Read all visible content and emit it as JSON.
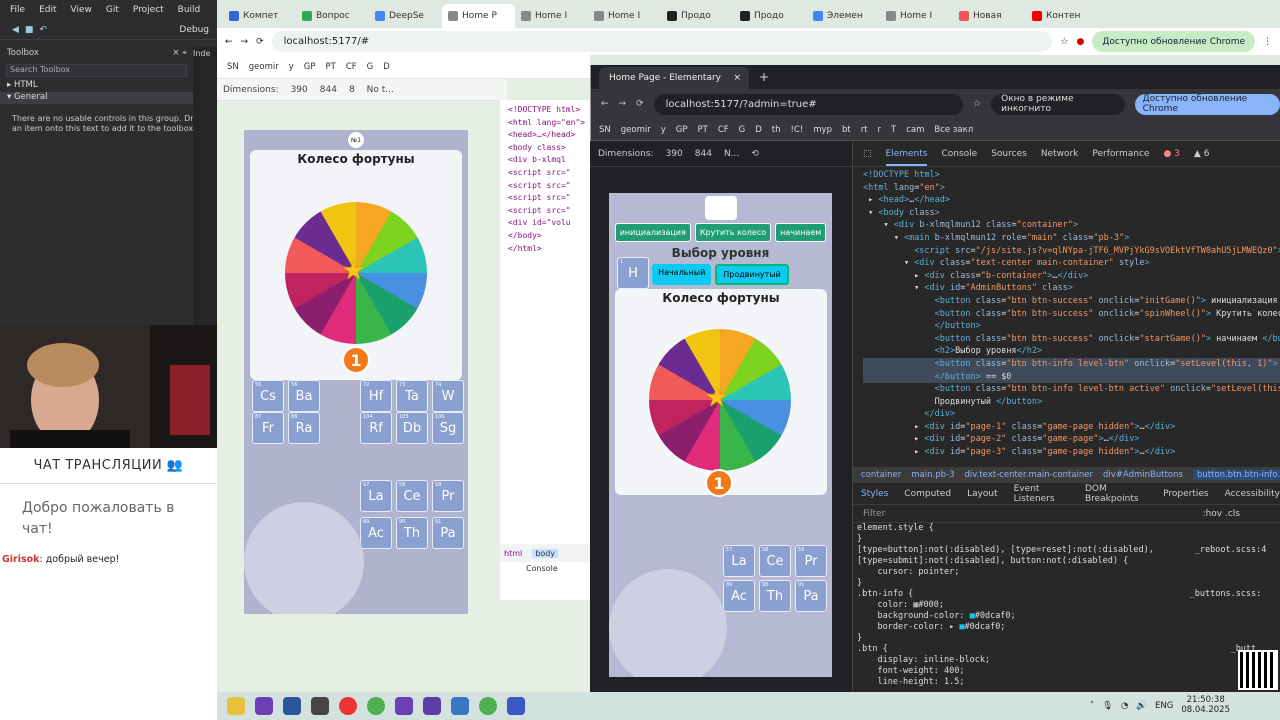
{
  "vs": {
    "menu": [
      "File",
      "Edit",
      "View",
      "Git",
      "Project",
      "Build"
    ],
    "toolbar_item": "Debug",
    "toolbox_title": "Toolbox",
    "search": "Search Toolbox",
    "groups": [
      "HTML",
      "General"
    ],
    "empty_msg": "There are no usable controls in this group. Drag an item onto this text to add it to the toolbox."
  },
  "chat": {
    "title": "ЧАТ ТРАНСЛЯЦИИ",
    "welcome": "Добро пожаловать в чат!",
    "user": "Girisok",
    "message": ": добрый вечер!"
  },
  "browser1": {
    "tabs": [
      "Компет",
      "Вопрос",
      "DeepSe",
      "Home P",
      "Home I",
      "Home I",
      "Продо",
      "Продо",
      "Элемен",
      "Home I",
      "Новая",
      "Контен"
    ],
    "url": "localhost:5177/#",
    "update": "Доступно обновление Chrome",
    "bookmarks": [
      "SN",
      "geomir",
      "y",
      "GP",
      "PT",
      "CF",
      "G",
      "D"
    ],
    "dim_label": "Dimensions:",
    "dim_w": "390",
    "dim_h": "844",
    "dim_zoom": "8",
    "throttle": "No t..."
  },
  "dev_small": {
    "lines": [
      "<!DOCTYPE html>",
      "<html lang=\"en\">",
      "<head>…</head>",
      "<body class>",
      "<div b-xlmql",
      "<script src=\"",
      "<script src=\"",
      "<script src=\"",
      "<script src=\"",
      "<div id=\"volu",
      "</body>",
      "</html>"
    ],
    "crumbs": [
      "html",
      "body"
    ],
    "console": "Console"
  },
  "browser2": {
    "tab": "Home Page - Elementary",
    "url": "localhost:5177/?admin=true#",
    "incognito": "Окно в режиме инкогнито",
    "update": "Доступно обновление Chrome",
    "bookmarks": [
      "SN",
      "geomir",
      "y",
      "GP",
      "PT",
      "CF",
      "G",
      "D",
      "th",
      "!C!",
      "myp",
      "bt",
      "rt",
      "r",
      "T",
      "cam",
      "Все закл"
    ],
    "dim_label": "Dimensions:",
    "dim_w": "390",
    "dim_h": "844",
    "throttle": "N..."
  },
  "game": {
    "admin_buttons": [
      "инициализация",
      "Крутить колесо",
      "начинаем"
    ],
    "level_title": "Выбор уровня",
    "levels": [
      "Начальный",
      "Продвинутый"
    ],
    "wheel_title": "Колесо фортуны",
    "badge": "1",
    "badge_small": "№1",
    "elements_top": [
      "H"
    ],
    "elements": [
      {
        "s": "La",
        "n": "57"
      },
      {
        "s": "Ce",
        "n": "58"
      },
      {
        "s": "Pr",
        "n": "59"
      },
      {
        "s": "Ac",
        "n": "89"
      },
      {
        "s": "Th",
        "n": "90"
      },
      {
        "s": "Pa",
        "n": "91"
      }
    ],
    "elements_small": [
      {
        "s": "Cs",
        "n": "55"
      },
      {
        "s": "Ba",
        "n": "56"
      },
      {
        "s": "Hf",
        "n": "72"
      },
      {
        "s": "Ta",
        "n": "73"
      },
      {
        "s": "W",
        "n": "74"
      },
      {
        "s": "Fr",
        "n": "87"
      },
      {
        "s": "Ra",
        "n": "88"
      },
      {
        "s": "Rf",
        "n": "104"
      },
      {
        "s": "Db",
        "n": "105"
      },
      {
        "s": "Sg",
        "n": "106"
      },
      {
        "s": "La",
        "n": "57"
      },
      {
        "s": "Ce",
        "n": "58"
      },
      {
        "s": "Pr",
        "n": "59"
      },
      {
        "s": "Ac",
        "n": "89"
      },
      {
        "s": "Th",
        "n": "90"
      },
      {
        "s": "Pa",
        "n": "91"
      }
    ]
  },
  "devtools": {
    "tabs": [
      "Elements",
      "Console",
      "Sources",
      "Network",
      "Performance"
    ],
    "errors": "3",
    "warnings": "6",
    "crumbs": [
      "container",
      "main.pb-3",
      "div.text-center.main-container",
      "div#AdminButtons",
      "button.btn.btn-info.level-btn"
    ],
    "style_tabs": [
      "Styles",
      "Computed",
      "Layout",
      "Event Listeners",
      "DOM Breakpoints",
      "Properties",
      "Accessibility"
    ],
    "filter": "Filter",
    "filter_hints": ":hov .cls"
  },
  "taskbar": {
    "lang": "ENG",
    "time": "21:50:38",
    "date": "08.04.2025"
  }
}
